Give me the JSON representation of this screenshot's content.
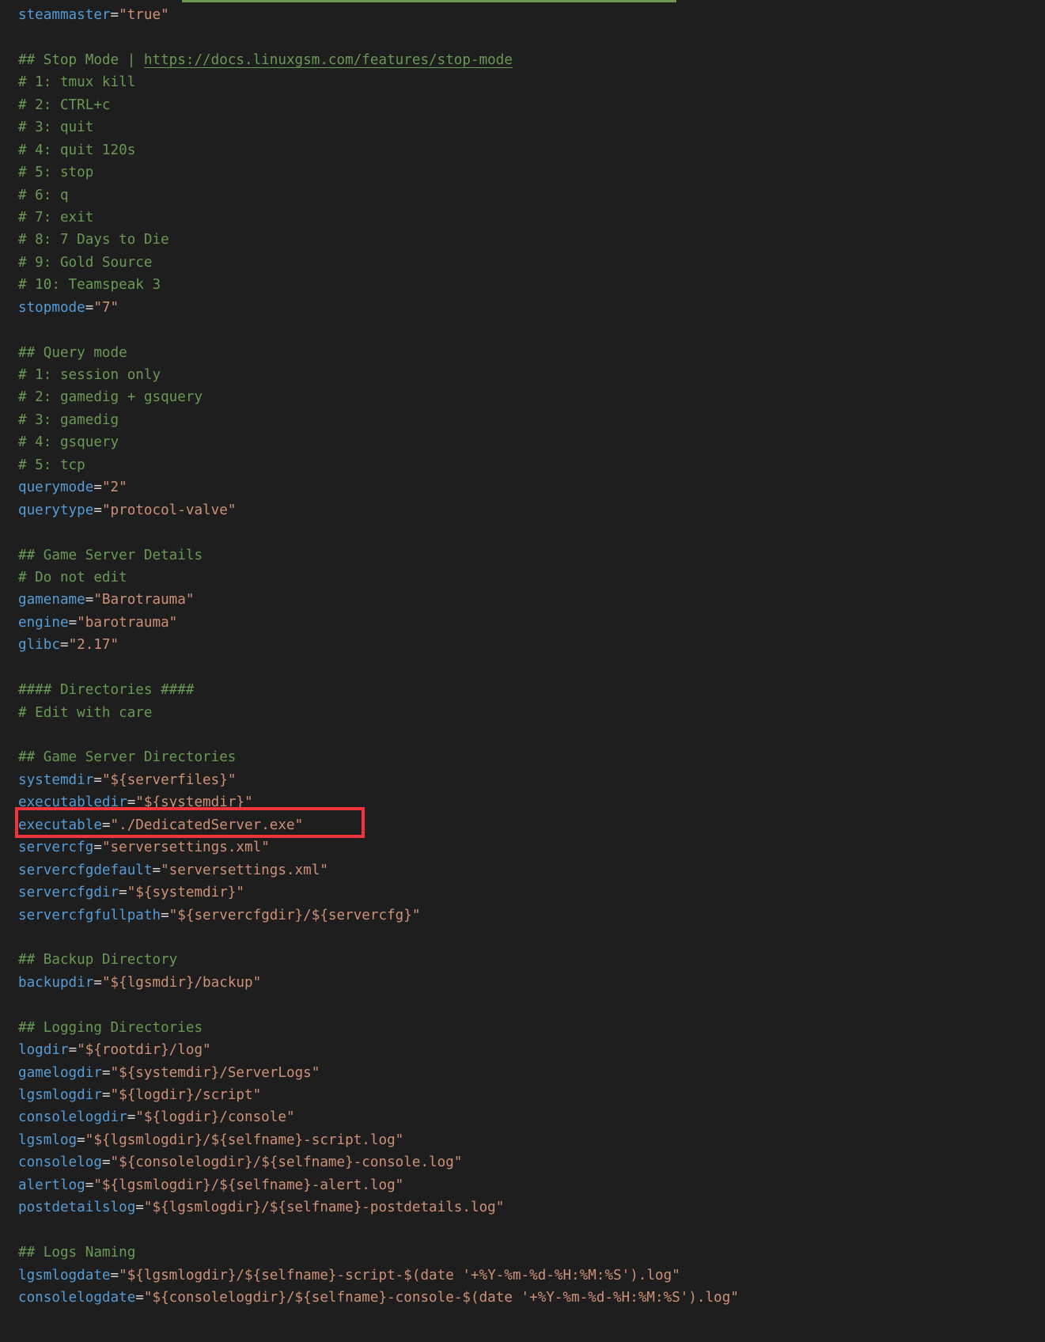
{
  "lines": [
    {
      "type": "kv",
      "key": "steammaster",
      "value": "\"true\""
    },
    {
      "type": "blank"
    },
    {
      "type": "link-comment",
      "prefix": "## Stop Mode | ",
      "link": "https://docs.linuxgsm.com/features/stop-mode"
    },
    {
      "type": "comment",
      "text": "# 1: tmux kill"
    },
    {
      "type": "comment",
      "text": "# 2: CTRL+c"
    },
    {
      "type": "comment",
      "text": "# 3: quit"
    },
    {
      "type": "comment",
      "text": "# 4: quit 120s"
    },
    {
      "type": "comment",
      "text": "# 5: stop"
    },
    {
      "type": "comment",
      "text": "# 6: q"
    },
    {
      "type": "comment",
      "text": "# 7: exit"
    },
    {
      "type": "comment",
      "text": "# 8: 7 Days to Die"
    },
    {
      "type": "comment",
      "text": "# 9: Gold Source"
    },
    {
      "type": "comment",
      "text": "# 10: Teamspeak 3"
    },
    {
      "type": "kv",
      "key": "stopmode",
      "value": "\"7\""
    },
    {
      "type": "blank"
    },
    {
      "type": "comment",
      "text": "## Query mode"
    },
    {
      "type": "comment",
      "text": "# 1: session only"
    },
    {
      "type": "comment",
      "text": "# 2: gamedig + gsquery"
    },
    {
      "type": "comment",
      "text": "# 3: gamedig"
    },
    {
      "type": "comment",
      "text": "# 4: gsquery"
    },
    {
      "type": "comment",
      "text": "# 5: tcp"
    },
    {
      "type": "kv",
      "key": "querymode",
      "value": "\"2\""
    },
    {
      "type": "kv",
      "key": "querytype",
      "value": "\"protocol-valve\""
    },
    {
      "type": "blank"
    },
    {
      "type": "comment",
      "text": "## Game Server Details"
    },
    {
      "type": "comment",
      "text": "# Do not edit"
    },
    {
      "type": "kv",
      "key": "gamename",
      "value": "\"Barotrauma\""
    },
    {
      "type": "kv",
      "key": "engine",
      "value": "\"barotrauma\""
    },
    {
      "type": "kv",
      "key": "glibc",
      "value": "\"2.17\""
    },
    {
      "type": "blank"
    },
    {
      "type": "comment",
      "text": "#### Directories ####"
    },
    {
      "type": "comment",
      "text": "# Edit with care"
    },
    {
      "type": "blank"
    },
    {
      "type": "comment",
      "text": "## Game Server Directories"
    },
    {
      "type": "kv",
      "key": "systemdir",
      "value": "\"${serverfiles}\""
    },
    {
      "type": "kv",
      "key": "executabledir",
      "value": "\"${systemdir}\""
    },
    {
      "type": "kv",
      "key": "executable",
      "value": "\"./DedicatedServer.exe\"",
      "highlighted": true
    },
    {
      "type": "kv",
      "key": "servercfg",
      "value": "\"serversettings.xml\""
    },
    {
      "type": "kv",
      "key": "servercfgdefault",
      "value": "\"serversettings.xml\""
    },
    {
      "type": "kv",
      "key": "servercfgdir",
      "value": "\"${systemdir}\""
    },
    {
      "type": "kv",
      "key": "servercfgfullpath",
      "value": "\"${servercfgdir}/${servercfg}\""
    },
    {
      "type": "blank"
    },
    {
      "type": "comment",
      "text": "## Backup Directory"
    },
    {
      "type": "kv",
      "key": "backupdir",
      "value": "\"${lgsmdir}/backup\""
    },
    {
      "type": "blank"
    },
    {
      "type": "comment",
      "text": "## Logging Directories"
    },
    {
      "type": "kv",
      "key": "logdir",
      "value": "\"${rootdir}/log\""
    },
    {
      "type": "kv",
      "key": "gamelogdir",
      "value": "\"${systemdir}/ServerLogs\""
    },
    {
      "type": "kv",
      "key": "lgsmlogdir",
      "value": "\"${logdir}/script\""
    },
    {
      "type": "kv",
      "key": "consolelogdir",
      "value": "\"${logdir}/console\""
    },
    {
      "type": "kv",
      "key": "lgsmlog",
      "value": "\"${lgsmlogdir}/${selfname}-script.log\""
    },
    {
      "type": "kv",
      "key": "consolelog",
      "value": "\"${consolelogdir}/${selfname}-console.log\""
    },
    {
      "type": "kv",
      "key": "alertlog",
      "value": "\"${lgsmlogdir}/${selfname}-alert.log\""
    },
    {
      "type": "kv",
      "key": "postdetailslog",
      "value": "\"${lgsmlogdir}/${selfname}-postdetails.log\""
    },
    {
      "type": "blank"
    },
    {
      "type": "comment",
      "text": "## Logs Naming"
    },
    {
      "type": "kv",
      "key": "lgsmlogdate",
      "value": "\"${lgsmlogdir}/${selfname}-script-$(date '+%Y-%m-%d-%H:%M:%S').log\""
    },
    {
      "type": "kv",
      "key": "consolelogdate",
      "value": "\"${consolelogdir}/${selfname}-console-$(date '+%Y-%m-%d-%H:%M:%S').log\""
    }
  ],
  "eq": "=",
  "colors": {
    "comment": "#6a9955",
    "key": "#569cd6",
    "string": "#ce9178",
    "highlight": "#f0343b",
    "background": "#1e1e1e"
  }
}
